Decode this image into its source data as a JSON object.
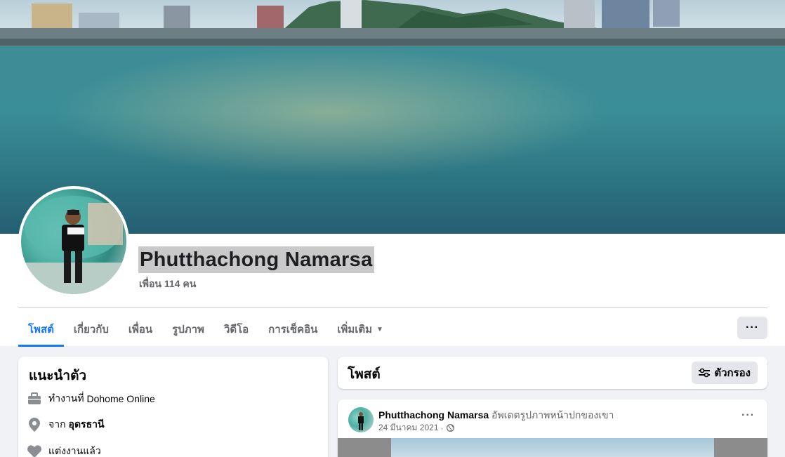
{
  "profile": {
    "name": "Phutthachong Namarsa",
    "friends": "เพื่อน 114 คน"
  },
  "tabs": [
    {
      "label": "โพสต์",
      "active": true
    },
    {
      "label": "เกี่ยวกับ"
    },
    {
      "label": "เพื่อน"
    },
    {
      "label": "รูปภาพ"
    },
    {
      "label": "วิดีโอ"
    },
    {
      "label": "การเช็คอิน"
    },
    {
      "label": "เพิ่มเติม",
      "dropdown": true
    }
  ],
  "more_button": "···",
  "intro": {
    "title": "แนะนำตัว",
    "work_prefix": "ทำงานที่",
    "work_place": "Dohome Online",
    "from_prefix": "จาก",
    "from_place": "อุดรธานี",
    "relationship": "แต่งงานแล้ว"
  },
  "posts": {
    "title": "โพสต์",
    "filter_label": "ตัวกรอง"
  },
  "post": {
    "author": "Phutthachong Namarsa",
    "action": "อัพเดตรูปภาพหน้าปกของเขา",
    "date": "24 มีนาคม 2021",
    "dot": "·",
    "menu": "···"
  },
  "colors": {
    "accent": "#1877f2",
    "background": "#f0f2f5",
    "button_gray": "#e4e6eb",
    "secondary_text": "#65676b"
  },
  "icons": {
    "work": "briefcase-icon",
    "location": "location-pin-icon",
    "relationship": "heart-icon",
    "filter": "sliders-icon",
    "audience": "globe-icon"
  }
}
